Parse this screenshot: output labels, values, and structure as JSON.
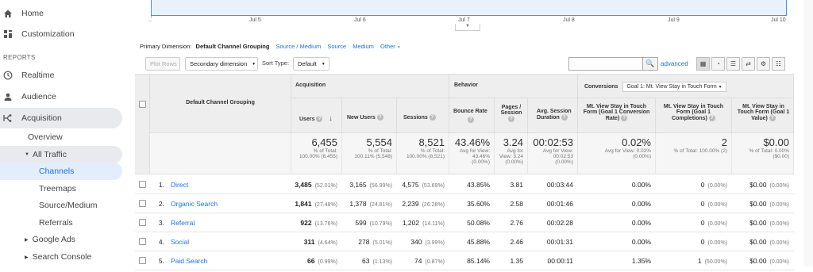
{
  "sidebar": {
    "home": "Home",
    "customization": "Customization",
    "reports": "REPORTS",
    "realtime": "Realtime",
    "audience": "Audience",
    "acquisition": "Acquisition",
    "overview": "Overview",
    "all_traffic": "All Traffic",
    "channels": "Channels",
    "treemaps": "Treemaps",
    "source_medium": "Source/Medium",
    "referrals": "Referrals",
    "google_ads": "Google Ads",
    "search_console": "Search Console"
  },
  "chart": {
    "x_ticks": [
      "Jul 5",
      "Jul 6",
      "Jul 7",
      "Jul 8",
      "Jul 9",
      "Jul 10"
    ]
  },
  "primary_dimension": {
    "label": "Primary Dimension:",
    "current": "Default Channel Grouping",
    "options": [
      "Source / Medium",
      "Source",
      "Medium",
      "Other"
    ]
  },
  "toolbar": {
    "plot_rows": "Plot Rows",
    "secondary_dimension": "Secondary dimension",
    "sort_type_label": "Sort Type:",
    "sort_type_value": "Default",
    "search_value": "",
    "advanced": "advanced"
  },
  "table": {
    "dimension_header": "Default Channel Grouping",
    "group_acquisition": "Acquisition",
    "group_behavior": "Behavior",
    "group_conversions": "Conversions",
    "goal_select": "Goal 1: Mt. View Stay in Touch Form",
    "columns": {
      "users": "Users",
      "new_users": "New Users",
      "sessions": "Sessions",
      "bounce_rate": "Bounce Rate",
      "pages_session": "Pages / Session",
      "avg_duration": "Avg. Session Duration",
      "conv_rate": "Mt. View Stay in Touch Form (Goal 1 Conversion Rate)",
      "completions": "Mt. View Stay in Touch Form (Goal 1 Completions)",
      "value": "Mt. View Stay in Touch Form (Goal 1 Value)"
    },
    "totals": {
      "users": {
        "v": "6,455",
        "s1": "% of Total:",
        "s2": "100.00% (6,455)"
      },
      "new_users": {
        "v": "5,554",
        "s1": "% of Total:",
        "s2": "100.11% (5,548)"
      },
      "sessions": {
        "v": "8,521",
        "s1": "% of Total:",
        "s2": "100.00% (8,521)"
      },
      "bounce_rate": {
        "v": "43.46%",
        "s1": "Avg for View:",
        "s2": "43.46%",
        "s3": "(0.00%)"
      },
      "pages_session": {
        "v": "3.24",
        "s1": "Avg for",
        "s2": "View: 3.24",
        "s3": "(0.00%)"
      },
      "avg_duration": {
        "v": "00:02:53",
        "s1": "Avg for View:",
        "s2": "00:02:53",
        "s3": "(0.00%)"
      },
      "conv_rate": {
        "v": "0.02%",
        "s1": "Avg for View: 0.02%",
        "s2": "(0.00%)"
      },
      "completions": {
        "v": "2",
        "s1": "% of Total: 100.00% (2)"
      },
      "value": {
        "v": "$0.00",
        "s1": "% of Total: 0.00%",
        "s2": "($0.00)"
      }
    },
    "rows": [
      {
        "idx": "1.",
        "name": "Direct",
        "users": "3,485",
        "users_pct": "(52.01%)",
        "new_users": "3,165",
        "new_users_pct": "(56.99%)",
        "sessions": "4,575",
        "sessions_pct": "(53.69%)",
        "bounce": "43.85%",
        "pages": "3.81",
        "duration": "00:03:44",
        "conv": "0.00%",
        "comp": "0",
        "comp_pct": "(0.00%)",
        "value": "$0.00",
        "value_pct": "(0.00%)"
      },
      {
        "idx": "2.",
        "name": "Organic Search",
        "users": "1,841",
        "users_pct": "(27.48%)",
        "new_users": "1,378",
        "new_users_pct": "(24.81%)",
        "sessions": "2,239",
        "sessions_pct": "(26.28%)",
        "bounce": "35.60%",
        "pages": "2.58",
        "duration": "00:01:46",
        "conv": "0.00%",
        "comp": "0",
        "comp_pct": "(0.00%)",
        "value": "$0.00",
        "value_pct": "(0.00%)"
      },
      {
        "idx": "3.",
        "name": "Referral",
        "users": "922",
        "users_pct": "(13.76%)",
        "new_users": "599",
        "new_users_pct": "(10.79%)",
        "sessions": "1,202",
        "sessions_pct": "(14.11%)",
        "bounce": "50.08%",
        "pages": "2.76",
        "duration": "00:02:28",
        "conv": "0.00%",
        "comp": "0",
        "comp_pct": "(0.00%)",
        "value": "$0.00",
        "value_pct": "(0.00%)"
      },
      {
        "idx": "4.",
        "name": "Social",
        "users": "311",
        "users_pct": "(4.64%)",
        "new_users": "278",
        "new_users_pct": "(5.01%)",
        "sessions": "340",
        "sessions_pct": "(3.99%)",
        "bounce": "45.88%",
        "pages": "2.46",
        "duration": "00:01:31",
        "conv": "0.00%",
        "comp": "0",
        "comp_pct": "(0.00%)",
        "value": "$0.00",
        "value_pct": "(0.00%)"
      },
      {
        "idx": "5.",
        "name": "Paid Search",
        "users": "66",
        "users_pct": "(0.99%)",
        "new_users": "63",
        "new_users_pct": "(1.13%)",
        "sessions": "74",
        "sessions_pct": "(0.87%)",
        "bounce": "85.14%",
        "pages": "1.35",
        "duration": "00:00:11",
        "conv": "1.35%",
        "comp": "1",
        "comp_pct": "(50.00%)",
        "value": "$0.00",
        "value_pct": "(0.00%)"
      }
    ]
  }
}
